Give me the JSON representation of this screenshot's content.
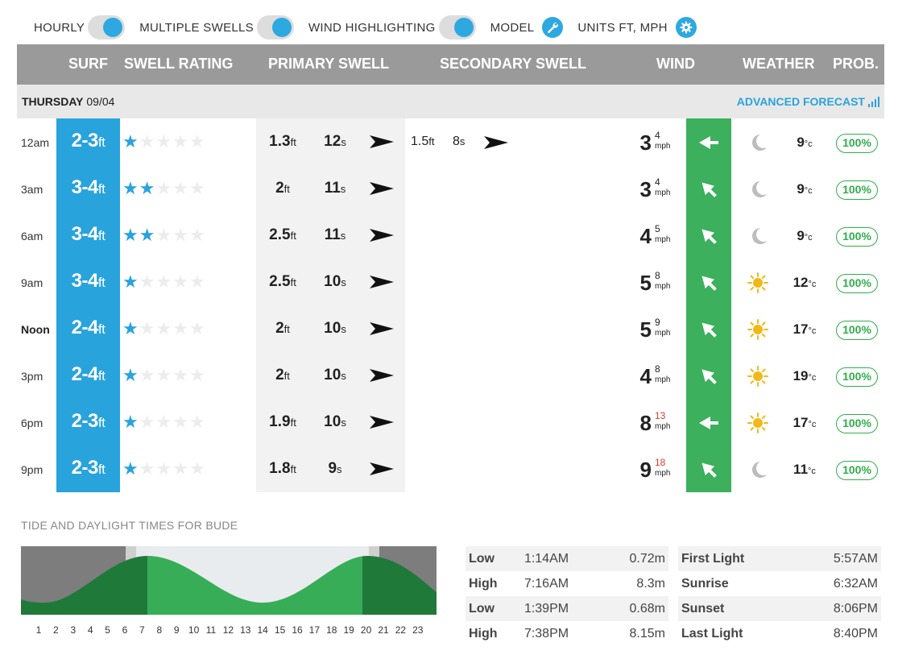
{
  "toggles": [
    {
      "label": "HOURLY",
      "type": "switch"
    },
    {
      "label": "MULTIPLE SWELLS",
      "type": "switch"
    },
    {
      "label": "WIND HIGHLIGHTING",
      "type": "switch"
    },
    {
      "label": "MODEL",
      "type": "wrench-icon"
    },
    {
      "label": "UNITS FT, MPH",
      "type": "gear-icon"
    }
  ],
  "header": {
    "surf": "SURF",
    "swell_rating": "SWELL RATING",
    "primary_swell": "PRIMARY SWELL",
    "secondary_swell": "SECONDARY SWELL",
    "wind": "WIND",
    "weather": "WEATHER",
    "prob": "PROB."
  },
  "day": {
    "name": "THURSDAY",
    "date": "09/04",
    "advanced": "ADVANCED FORECAST"
  },
  "rows": [
    {
      "time": "12am",
      "surf": "2-3",
      "rating": 1,
      "p_height": "1.3",
      "p_period": "12",
      "p_dir": 5,
      "s_height": "1.5",
      "s_period": "8",
      "s_dir": 5,
      "wind": "3",
      "gust": "4",
      "gust_red": false,
      "wind_dir": 180,
      "weather": "moon",
      "temp": "9"
    },
    {
      "time": "3am",
      "surf": "3-4",
      "rating": 2,
      "p_height": "2",
      "p_period": "11",
      "p_dir": 5,
      "wind": "3",
      "gust": "4",
      "gust_red": false,
      "wind_dir": 225,
      "weather": "moon",
      "temp": "9"
    },
    {
      "time": "6am",
      "surf": "3-4",
      "rating": 2,
      "p_height": "2.5",
      "p_period": "11",
      "p_dir": 5,
      "wind": "4",
      "gust": "5",
      "gust_red": false,
      "wind_dir": 225,
      "weather": "moon",
      "temp": "9"
    },
    {
      "time": "9am",
      "surf": "3-4",
      "rating": 1,
      "p_height": "2.5",
      "p_period": "10",
      "p_dir": 5,
      "wind": "5",
      "gust": "8",
      "gust_red": false,
      "wind_dir": 225,
      "weather": "sun",
      "temp": "12"
    },
    {
      "time": "Noon",
      "surf": "2-4",
      "rating": 1,
      "p_height": "2",
      "p_period": "10",
      "p_dir": 5,
      "wind": "5",
      "gust": "9",
      "gust_red": false,
      "wind_dir": 225,
      "weather": "sun",
      "temp": "17"
    },
    {
      "time": "3pm",
      "surf": "2-4",
      "rating": 1,
      "p_height": "2",
      "p_period": "10",
      "p_dir": 5,
      "wind": "4",
      "gust": "8",
      "gust_red": false,
      "wind_dir": 225,
      "weather": "sun",
      "temp": "19"
    },
    {
      "time": "6pm",
      "surf": "2-3",
      "rating": 1,
      "p_height": "1.9",
      "p_period": "10",
      "p_dir": 5,
      "wind": "8",
      "gust": "13",
      "gust_red": true,
      "wind_dir": 180,
      "weather": "sun",
      "temp": "17"
    },
    {
      "time": "9pm",
      "surf": "2-3",
      "rating": 1,
      "p_height": "1.8",
      "p_period": "9",
      "p_dir": 5,
      "wind": "9",
      "gust": "18",
      "gust_red": true,
      "wind_dir": 225,
      "weather": "moon",
      "temp": "11"
    }
  ],
  "units": {
    "ft": "ft",
    "s": "s",
    "mph": "mph",
    "c": "°c",
    "prob": "100%"
  },
  "tide": {
    "title": "TIDE AND DAYLIGHT TIMES FOR BUDE",
    "hours": [
      "1",
      "2",
      "3",
      "4",
      "5",
      "6",
      "7",
      "8",
      "9",
      "10",
      "11",
      "12",
      "13",
      "14",
      "15",
      "16",
      "17",
      "18",
      "19",
      "20",
      "21",
      "22",
      "23"
    ],
    "tides": [
      {
        "type": "Low",
        "time": "1:14AM",
        "height": "0.72m"
      },
      {
        "type": "High",
        "time": "7:16AM",
        "height": "8.3m"
      },
      {
        "type": "Low",
        "time": "1:39PM",
        "height": "0.68m"
      },
      {
        "type": "High",
        "time": "7:38PM",
        "height": "8.15m"
      }
    ],
    "lights": [
      {
        "label": "First Light",
        "time": "5:57AM"
      },
      {
        "label": "Sunrise",
        "time": "6:32AM"
      },
      {
        "label": "Sunset",
        "time": "8:06PM"
      },
      {
        "label": "Last Light",
        "time": "8:40PM"
      }
    ]
  },
  "colors": {
    "blue": "#29a3dc",
    "green": "#3cb05c",
    "dark_green": "#1f7a3a",
    "red": "#e03c31"
  }
}
